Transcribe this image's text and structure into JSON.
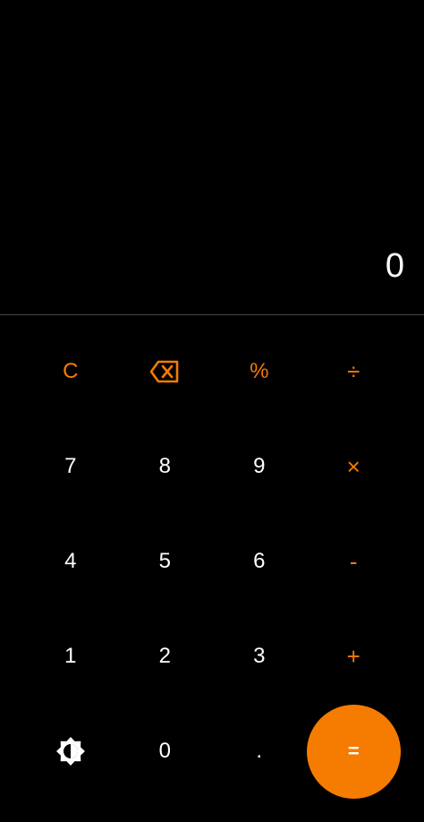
{
  "display": {
    "value": "0"
  },
  "keys": {
    "clear": "C",
    "backspace_icon": "backspace-icon",
    "percent": "%",
    "divide": "÷",
    "seven": "7",
    "eight": "8",
    "nine": "9",
    "multiply": "×",
    "four": "4",
    "five": "5",
    "six": "6",
    "minus": "-",
    "one": "1",
    "two": "2",
    "three": "3",
    "plus": "+",
    "theme_icon": "brightness-icon",
    "zero": "0",
    "decimal": ".",
    "equals": "="
  },
  "colors": {
    "background": "#000000",
    "accent": "#f57c00",
    "text": "#ffffff",
    "divider": "#4a4a4a"
  }
}
